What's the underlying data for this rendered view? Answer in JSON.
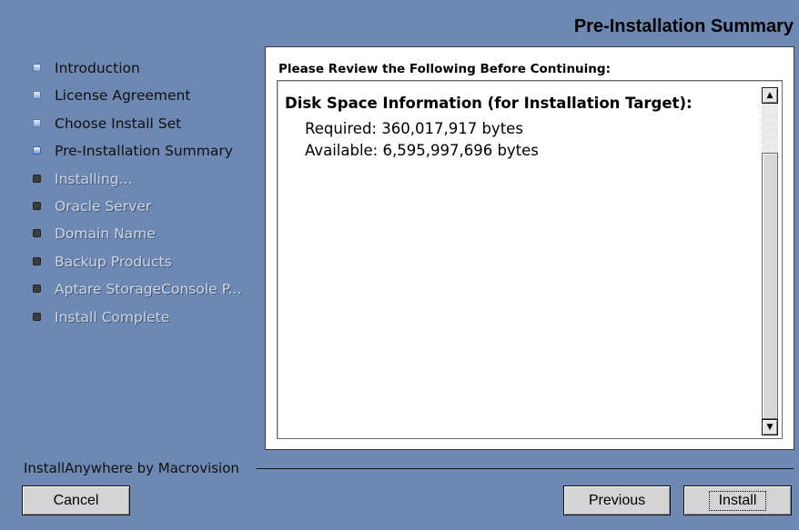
{
  "header": {
    "title": "Pre-Installation Summary"
  },
  "steps": [
    {
      "label": "Introduction",
      "state": "done"
    },
    {
      "label": "License Agreement",
      "state": "done"
    },
    {
      "label": "Choose Install Set",
      "state": "done"
    },
    {
      "label": "Pre-Installation Summary",
      "state": "current"
    },
    {
      "label": "Installing...",
      "state": "todo"
    },
    {
      "label": "Oracle Server",
      "state": "todo"
    },
    {
      "label": "Domain Name",
      "state": "todo"
    },
    {
      "label": "Backup Products",
      "state": "todo"
    },
    {
      "label": "Aptare StorageConsole P...",
      "state": "todo"
    },
    {
      "label": "Install Complete",
      "state": "todo"
    }
  ],
  "panel": {
    "heading": "Please Review the Following Before Continuing:",
    "info_heading": "Disk Space Information (for Installation Target):",
    "required": "Required: 360,017,917 bytes",
    "available": "Available: 6,595,997,696 bytes"
  },
  "scrollbar": {
    "up_glyph": "▲",
    "down_glyph": "▼"
  },
  "footer": {
    "brand": "InstallAnywhere by Macrovision",
    "cancel_label": "Cancel",
    "previous_label": "Previous",
    "install_label": "Install"
  },
  "colors": {
    "background": "#6c88b3",
    "panel": "#ffffff",
    "button": "#d4d4d4"
  }
}
